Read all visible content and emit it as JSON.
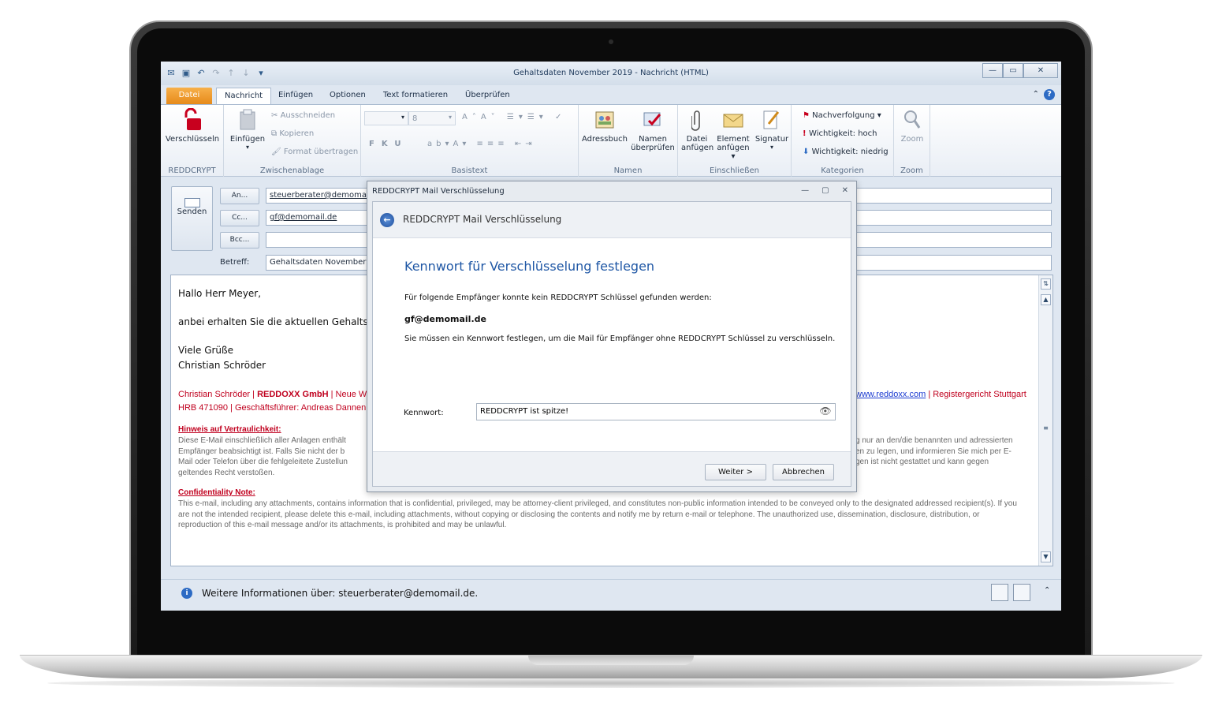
{
  "window": {
    "title": "Gehaltsdaten November 2019 - Nachricht (HTML)"
  },
  "tabs": [
    {
      "label": "Datei"
    },
    {
      "label": "Nachricht"
    },
    {
      "label": "Einfügen"
    },
    {
      "label": "Optionen"
    },
    {
      "label": "Text formatieren"
    },
    {
      "label": "Überprüfen"
    }
  ],
  "ribbon": {
    "reddcrypt": {
      "button": "Verschlüsseln",
      "group": "REDDCRYPT"
    },
    "clipboard": {
      "paste": "Einfügen",
      "cut": "Ausschneiden",
      "copy": "Kopieren",
      "format": "Format übertragen",
      "group": "Zwischenablage"
    },
    "basictext": {
      "fontsize": "8",
      "group": "Basistext"
    },
    "names": {
      "addressbook": "Adressbuch",
      "check_line1": "Namen",
      "check_line2": "überprüfen",
      "group": "Namen"
    },
    "include": {
      "file_line1": "Datei",
      "file_line2": "anfügen",
      "item_line1": "Element",
      "item_line2": "anfügen",
      "signature": "Signatur",
      "group": "Einschließen"
    },
    "tags": {
      "followup": "Nachverfolgung",
      "high": "Wichtigkeit: hoch",
      "low": "Wichtigkeit: niedrig",
      "group": "Kategorien"
    },
    "zoom": {
      "button": "Zoom",
      "group": "Zoom"
    }
  },
  "compose": {
    "send": "Senden",
    "to_button": "An...",
    "cc_button": "Cc...",
    "bcc_button": "Bcc...",
    "to_value": "steuerberater@demomail",
    "cc_value": "gf@demomail.de",
    "bcc_value": "",
    "subject_label": "Betreff:",
    "subject_value": "Gehaltsdaten November 2"
  },
  "body": {
    "greeting": "Hallo Herr Meyer,",
    "line1": "anbei erhalten Sie die aktuellen Gehalts",
    "closing": "Viele Grüße",
    "name": "Christian Schröder",
    "sig_name": "Christian Schröder",
    "sig_company": "REDDOXX GmbH",
    "sig_rest1": "| Neue W",
    "sig_link": "www.reddoxx.com",
    "sig_court": "| Registergericht Stuttgart",
    "sig_line2": "HRB 471090 | Geschäftsführer: Andreas Dannen",
    "hint_heading": "Hinweis auf Vertraulichkeit:",
    "hint_l1a": "Diese E-Mail einschließlich aller Anlagen enthält",
    "hint_l1b": "g nur an den/die benannten und adressierten",
    "hint_l2a": "Empfänger beabsichtigt ist. Falls Sie nicht der b",
    "hint_l2b": "en zu legen, und informieren Sie mich per E-",
    "hint_l3a": "Mail oder Telefon über die fehlgeleitete Zustellun",
    "hint_l3b": "gen ist nicht gestattet und kann gegen",
    "hint_l4a": "geltendes Recht verstoßen.",
    "conf_heading": "Confidentiality Note:",
    "conf_text": "This e-mail, including any attachments, contains information that is confidential, privileged, may be attorney-client privileged, and constitutes non-public information intended to be conveyed only to the designated addressed recipient(s). If you are not the intended recipient, please delete this e-mail, including attachments, without copying or disclosing the contents and notify me by return e-mail or telephone. The unauthorized use, dissemination, disclosure, distribution, or reproduction of this e-mail message and/or its attachments, is prohibited and may be unlawful."
  },
  "infobar": {
    "text": "Weitere Informationen über: steuerberater@demomail.de."
  },
  "dialog": {
    "title": "REDDCRYPT Mail Verschlüsselung",
    "band_title": "REDDCRYPT Mail Verschlüsselung",
    "heading": "Kennwort für Verschlüsselung festlegen",
    "text1": "Für folgende Empfänger konnte kein REDDCRYPT Schlüssel gefunden werden:",
    "recipient": "gf@demomail.de",
    "text2": "Sie müssen ein Kennwort festlegen, um die Mail für Empfänger ohne REDDCRYPT Schlüssel zu verschlüsseln.",
    "password_label": "Kennwort:",
    "password_value": "REDDCRYPT ist spitze!",
    "next_button": "Weiter >",
    "cancel_button": "Abbrechen"
  }
}
